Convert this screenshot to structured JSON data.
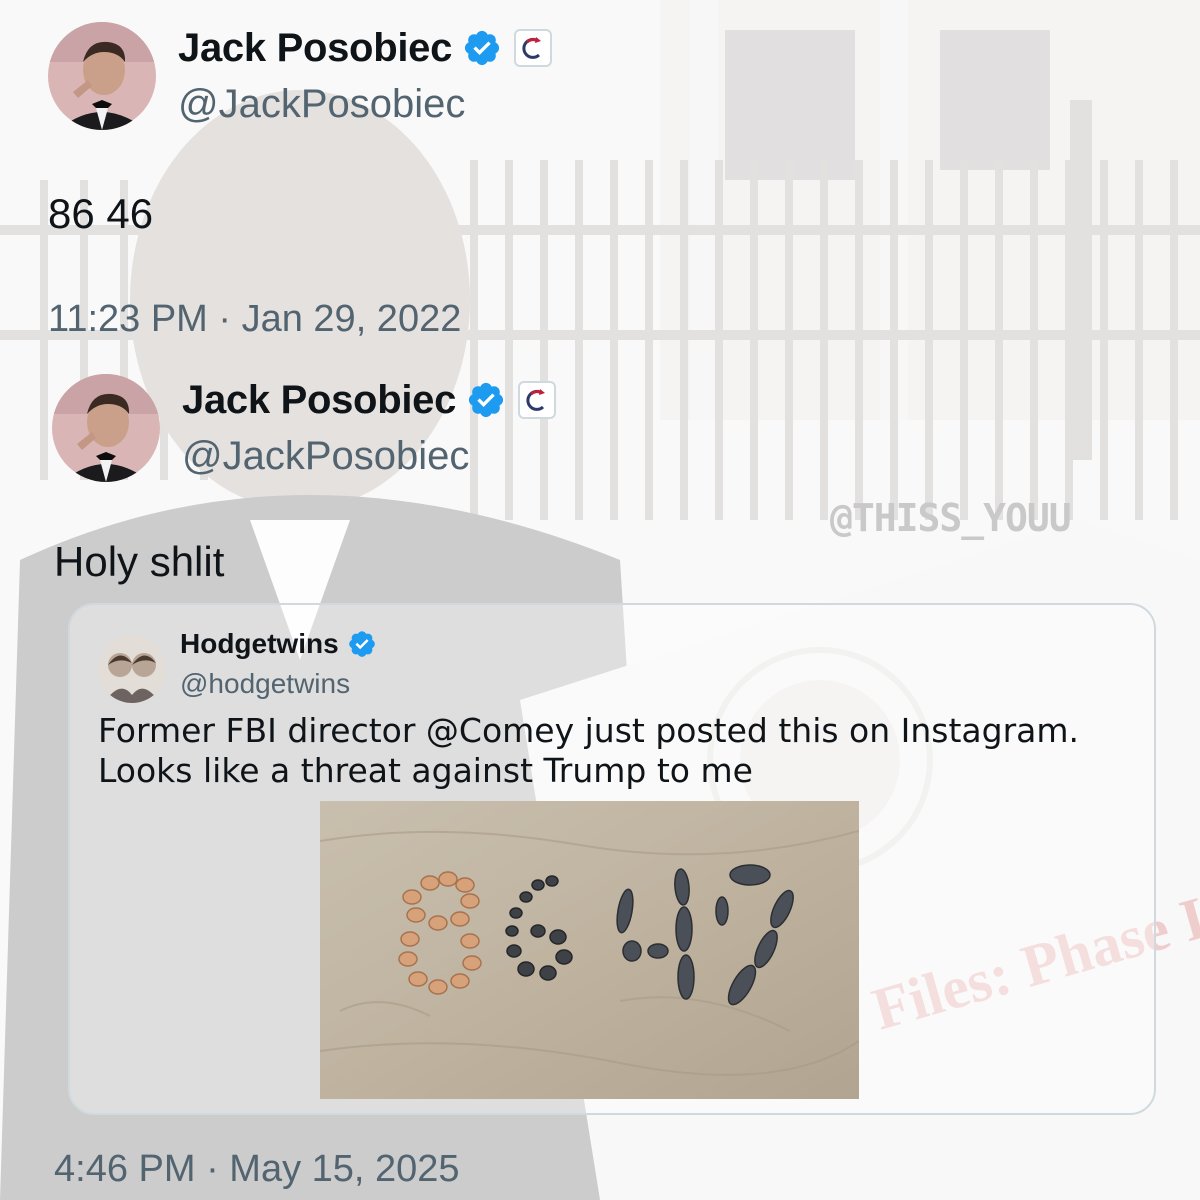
{
  "tweets": [
    {
      "author": {
        "name": "Jack Posobiec",
        "handle": "@JackPosobiec",
        "verified": true,
        "avatar": "avatar-man-pointing"
      },
      "text": "86 46",
      "timestamp": "11:23 PM · Jan 29, 2022"
    },
    {
      "author": {
        "name": "Jack Posobiec",
        "handle": "@JackPosobiec",
        "verified": true,
        "avatar": "avatar-man-pointing"
      },
      "text": "Holy shlit",
      "timestamp": "4:46 PM · May 15, 2025",
      "quote": {
        "author": {
          "name": "Hodgetwins",
          "handle": "@hodgetwins",
          "verified": true,
          "avatar": "avatar-twins-photo"
        },
        "text": "Former FBI director @Comey just posted this on Instagram. Looks like a threat against Trump to me",
        "media": {
          "description": "seashells arranged in sand",
          "shown_text": "8647"
        }
      }
    }
  ],
  "watermark": "@THISS_YOUU",
  "icons": {
    "verified": "verified-badge-icon",
    "affiliate": "affiliate-badge-icon"
  },
  "colors": {
    "verified_blue": "#1d9bf0",
    "secondary_text": "#536471",
    "border": "#cfd9de",
    "affiliate_red": "#c0203a"
  }
}
